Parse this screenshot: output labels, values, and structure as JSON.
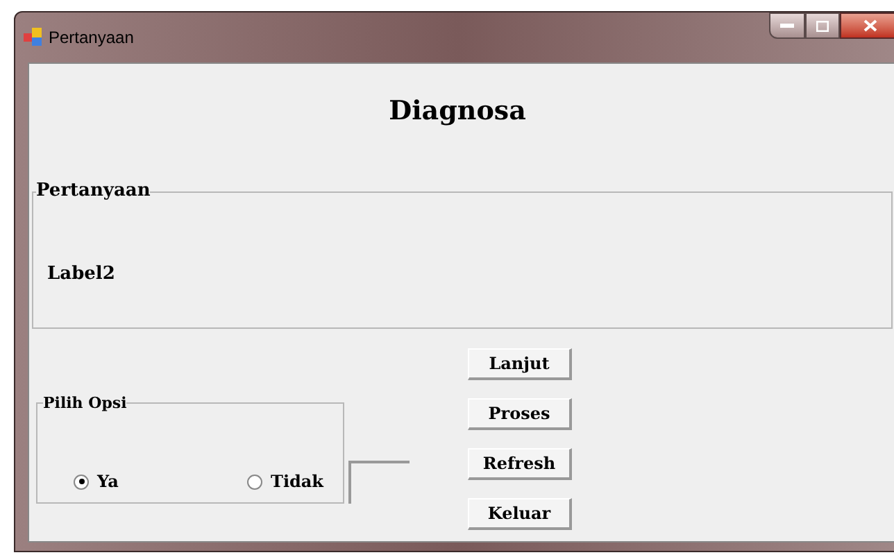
{
  "window": {
    "title": "Pertanyaan"
  },
  "heading": "Diagnosa",
  "question_group": {
    "title": "Pertanyaan",
    "label": "Label2"
  },
  "option_group": {
    "title": "Pilih Opsi",
    "options": [
      {
        "label": "Ya",
        "selected": true
      },
      {
        "label": "Tidak",
        "selected": false
      }
    ]
  },
  "buttons": [
    "Lanjut",
    "Proses",
    "Refresh",
    "Keluar"
  ]
}
